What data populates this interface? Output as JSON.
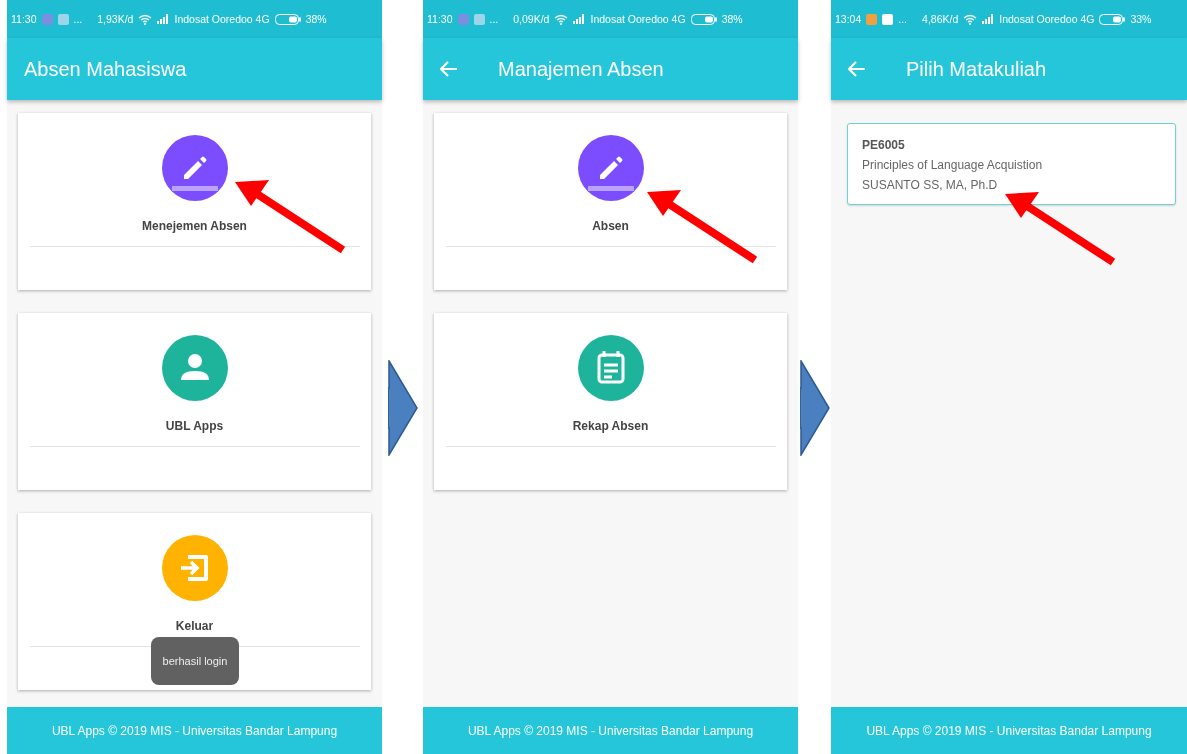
{
  "screens": [
    {
      "status_bar": {
        "time": "11:30",
        "more": "...",
        "speed": "1,93K/d",
        "carrier": "Indosat Ooredoo 4G",
        "battery": "38%"
      },
      "title": "Absen Mahasiswa",
      "has_back": false,
      "menu": [
        {
          "kind": "edit",
          "label": "Menejemen Absen",
          "color": "#7c4dff"
        },
        {
          "kind": "profile",
          "label": "UBL Apps",
          "color": "#1db49b"
        },
        {
          "kind": "exit",
          "label": "Keluar",
          "color": "#ffb300"
        }
      ],
      "toast": "berhasil login",
      "footer": "UBL Apps © 2019 MIS - Universitas Bandar Lampung"
    },
    {
      "status_bar": {
        "time": "11:30",
        "more": "...",
        "speed": "0,09K/d",
        "carrier": "Indosat Ooredoo 4G",
        "battery": "38%"
      },
      "title": "Manajemen Absen",
      "has_back": true,
      "menu": [
        {
          "kind": "edit",
          "label": "Absen",
          "color": "#7c4dff"
        },
        {
          "kind": "report",
          "label": "Rekap Absen",
          "color": "#1db49b"
        }
      ],
      "footer": "UBL Apps © 2019 MIS - Universitas Bandar Lampung"
    },
    {
      "status_bar": {
        "time": "13:04",
        "more": "...",
        "speed": "4,86K/d",
        "carrier": "Indosat Ooredoo 4G",
        "battery": "33%"
      },
      "title": "Pilih Matakuliah",
      "has_back": true,
      "courses": [
        {
          "code": "PE6005",
          "name": "Principles of Language Acquistion",
          "lecturer": "SUSANTO SS, MA, Ph.D"
        }
      ],
      "footer": "UBL Apps © 2019 MIS - Universitas Bandar Lampung"
    }
  ]
}
